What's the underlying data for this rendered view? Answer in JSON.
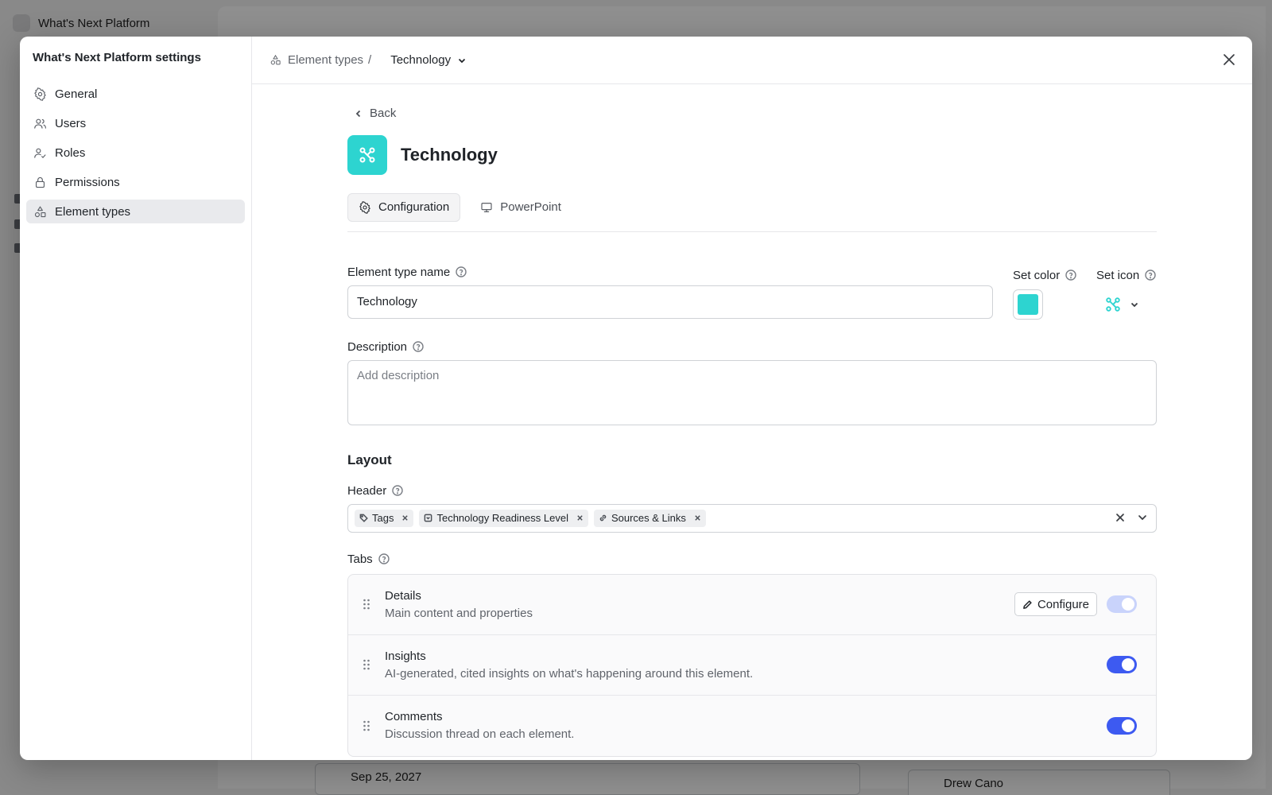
{
  "background": {
    "workspace_name": "What's Next Platform",
    "date_value": "Sep 25, 2027",
    "owner_value": "Drew Cano"
  },
  "modal": {
    "settings_title": "What's Next Platform settings",
    "nav": [
      {
        "label": "General",
        "icon": "gear-icon"
      },
      {
        "label": "Users",
        "icon": "users-icon"
      },
      {
        "label": "Roles",
        "icon": "user-check-icon"
      },
      {
        "label": "Permissions",
        "icon": "lock-icon"
      },
      {
        "label": "Element types",
        "icon": "shapes-icon",
        "active": true
      }
    ],
    "breadcrumb": {
      "parent": "Element types",
      "separator": "/",
      "current": "Technology"
    }
  },
  "element_type": {
    "back_label": "Back",
    "title": "Technology",
    "color": "#2dd4d0",
    "icon": "network-icon",
    "tabs": [
      {
        "label": "Configuration",
        "icon": "gear-icon",
        "active": true
      },
      {
        "label": "PowerPoint",
        "icon": "presentation-icon",
        "active": false
      }
    ],
    "form": {
      "name_label": "Element type name",
      "name_value": "Technology",
      "color_label": "Set color",
      "icon_label": "Set icon",
      "description_label": "Description",
      "description_placeholder": "Add description"
    },
    "layout": {
      "section_title": "Layout",
      "header_label": "Header",
      "header_chips": [
        {
          "label": "Tags",
          "icon": "tag-icon"
        },
        {
          "label": "Technology Readiness Level",
          "icon": "select-icon"
        },
        {
          "label": "Sources & Links",
          "icon": "link-icon"
        }
      ],
      "tabs_label": "Tabs",
      "tab_rows": [
        {
          "name": "Details",
          "desc": "Main content and properties",
          "configure_label": "Configure",
          "enabled": true,
          "locked": true
        },
        {
          "name": "Insights",
          "desc": "AI-generated, cited insights on what's happening around this element.",
          "enabled": true,
          "locked": false
        },
        {
          "name": "Comments",
          "desc": "Discussion thread on each element.",
          "enabled": true,
          "locked": false
        }
      ]
    }
  }
}
